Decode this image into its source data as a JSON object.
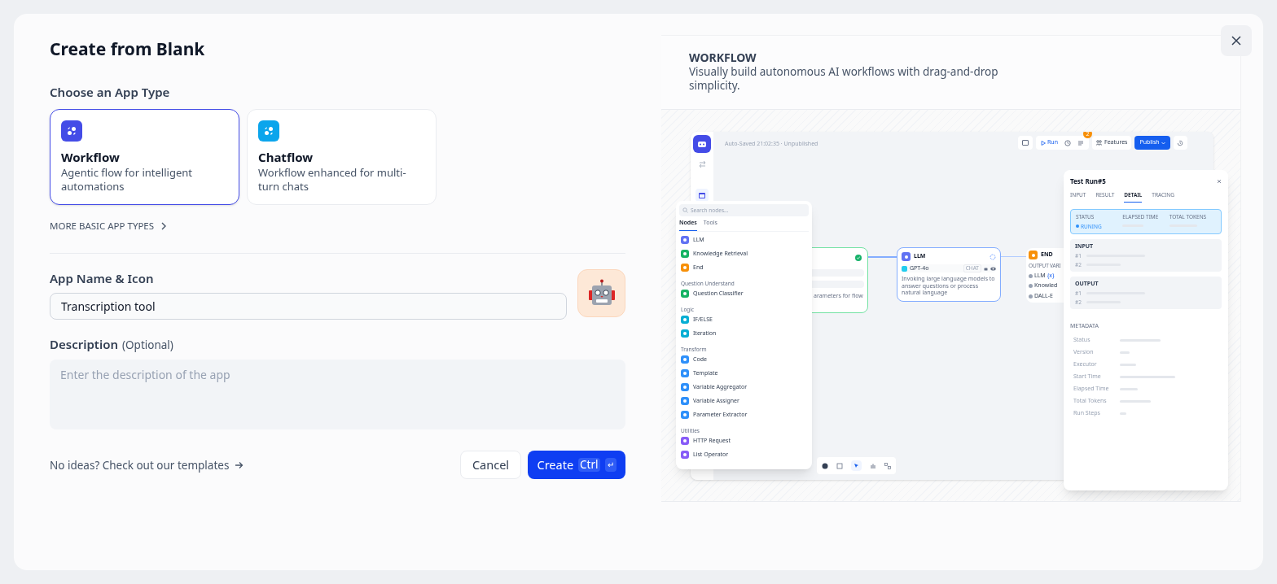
{
  "dialog": {
    "title": "Create from Blank"
  },
  "app_type": {
    "label": "Choose an App Type",
    "more_link": "MORE BASIC APP TYPES",
    "options": [
      {
        "name": "Workflow",
        "description": "Agentic flow for intelligent automations",
        "selected": true,
        "color": "#444ce7"
      },
      {
        "name": "Chatflow",
        "description": "Workflow enhanced for multi-turn chats",
        "selected": false,
        "color": "#0ba5ec"
      }
    ]
  },
  "app_name": {
    "label": "App Name & Icon",
    "value": "Transcription tool"
  },
  "description": {
    "label": "Description",
    "optional": "(Optional)",
    "placeholder": "Enter the description of the app"
  },
  "templates_link": "No ideas? Check out our templates",
  "buttons": {
    "cancel": "Cancel",
    "create": "Create",
    "shortcut": "Ctrl",
    "enter_key": "↵"
  },
  "preview": {
    "title": "WORKFLOW",
    "description": "Visually build autonomous AI workflows with drag-and-drop simplicity.",
    "screenshot": {
      "autosave": "Auto-Saved 21:02:35 · Unpublished",
      "toolbar": {
        "run": "Run",
        "badge": "2",
        "features": "Features",
        "publish": "Publish"
      },
      "node_panel": {
        "search_placeholder": "Search nodes...",
        "tabs": [
          {
            "label": "Nodes",
            "selected": true
          },
          {
            "label": "Tools",
            "selected": false
          }
        ],
        "groups": [
          {
            "items": [
              {
                "name": "LLM",
                "color": "#6172f3"
              },
              {
                "name": "Knowledge Retrieval",
                "color": "#16b364"
              },
              {
                "name": "End",
                "color": "#f79009"
              }
            ]
          },
          {
            "title": "Question Understand",
            "items": [
              {
                "name": "Question Classifier",
                "color": "#16b364"
              }
            ]
          },
          {
            "title": "Logic",
            "items": [
              {
                "name": "IF/ELSE",
                "color": "#06aed4"
              },
              {
                "name": "Iteration",
                "color": "#06aed4"
              }
            ]
          },
          {
            "title": "Transform",
            "items": [
              {
                "name": "Code",
                "color": "#2e90fa"
              },
              {
                "name": "Template",
                "color": "#2e90fa"
              },
              {
                "name": "Variable Aggregator",
                "color": "#2e90fa"
              },
              {
                "name": "Variable Assigner",
                "color": "#2e90fa"
              },
              {
                "name": "Parameter Extractor",
                "color": "#2e90fa"
              }
            ]
          },
          {
            "title": "Utilities",
            "items": [
              {
                "name": "HTTP Request",
                "color": "#875bf7"
              },
              {
                "name": "List Operator",
                "color": "#875bf7"
              }
            ]
          }
        ]
      },
      "start_node": {
        "description": "arameters for flow"
      },
      "llm_node": {
        "title": "LLM",
        "model": "GPT-4o",
        "mode": "CHAT",
        "description": "Invoking large language models to answer questions or process natural language"
      },
      "end_node": {
        "title": "END",
        "output_label": "OUTPUT VARI",
        "outputs": [
          {
            "name": "LLM",
            "tag": "{x}"
          },
          {
            "name": "Knowled"
          },
          {
            "name": "DALL-E"
          }
        ]
      },
      "run_panel": {
        "title": "Test Run#5",
        "tabs": [
          {
            "label": "INPUT",
            "selected": false
          },
          {
            "label": "RESULT",
            "selected": false
          },
          {
            "label": "DETAIL",
            "selected": true
          },
          {
            "label": "TRACING",
            "selected": false
          }
        ],
        "status_label": "STATUS",
        "status": "RUNING",
        "elapsed_label": "ELAPSED TIME",
        "tokens_label": "TOTAL TOKENS",
        "sections": [
          {
            "title": "INPUT",
            "rows": [
              "#1",
              "#2"
            ]
          },
          {
            "title": "OUTPUT",
            "rows": [
              "#1",
              "#2"
            ]
          }
        ],
        "metadata_title": "METADATA",
        "metadata": [
          "Status",
          "Version",
          "Executor",
          "Start Time",
          "Elapsed Time",
          "Total Tokens",
          "Run Steps"
        ]
      }
    }
  }
}
